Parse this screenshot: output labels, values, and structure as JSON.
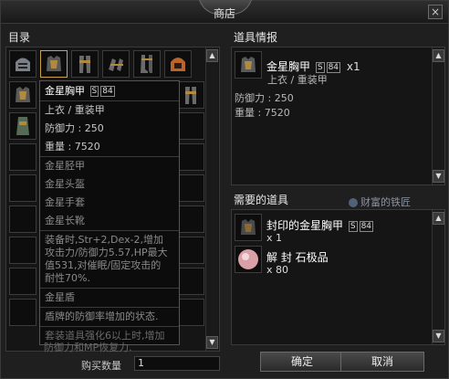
{
  "window": {
    "title": "商店",
    "close_symbol": "×"
  },
  "catalog": {
    "label": "目录"
  },
  "item_info": {
    "label": "道具情报",
    "name": "金星胸甲",
    "grade": "S",
    "grade_num": "84",
    "count": "x1",
    "type": "上衣 / 重装甲",
    "defense": "防御力 : 250",
    "weight": "重量 : 7520"
  },
  "tooltip": {
    "name": "金星胸甲",
    "grade": "S",
    "grade_num": "84",
    "type": "上衣 / 重装甲",
    "defense": "防御力 : 250",
    "weight": "重量 : 7520",
    "set_parts": [
      "金星胫甲",
      "金星头盔",
      "金星手套",
      "金星长靴"
    ],
    "set_effect": [
      "装备时,Str+2,Dex-2,增加",
      "攻击力/防御力5.57,HP最大",
      "值531,对催眠/固定攻击的",
      "耐性70%."
    ],
    "shield": "金星盾",
    "shield_effect": "盾牌的防御率增加的状态.",
    "enchant_effect": [
      "套装道具强化6以上时,增加",
      "防御力和MP恢复力."
    ]
  },
  "required": {
    "label": "需要的道具",
    "watermark": "财富的铁匠",
    "items": [
      {
        "name": "封印的金星胸甲",
        "grade": "S",
        "grade_num": "84",
        "count": "x 1"
      },
      {
        "name": "解 封 石极品",
        "count": "x 80"
      }
    ]
  },
  "purchase": {
    "qty_label": "购买数量",
    "qty_value": "1"
  },
  "buttons": {
    "ok": "确定",
    "cancel": "取消"
  },
  "colors": {
    "gold_border": "#c9a24a",
    "bg": "#1f1f1f",
    "panel": "#151515"
  }
}
